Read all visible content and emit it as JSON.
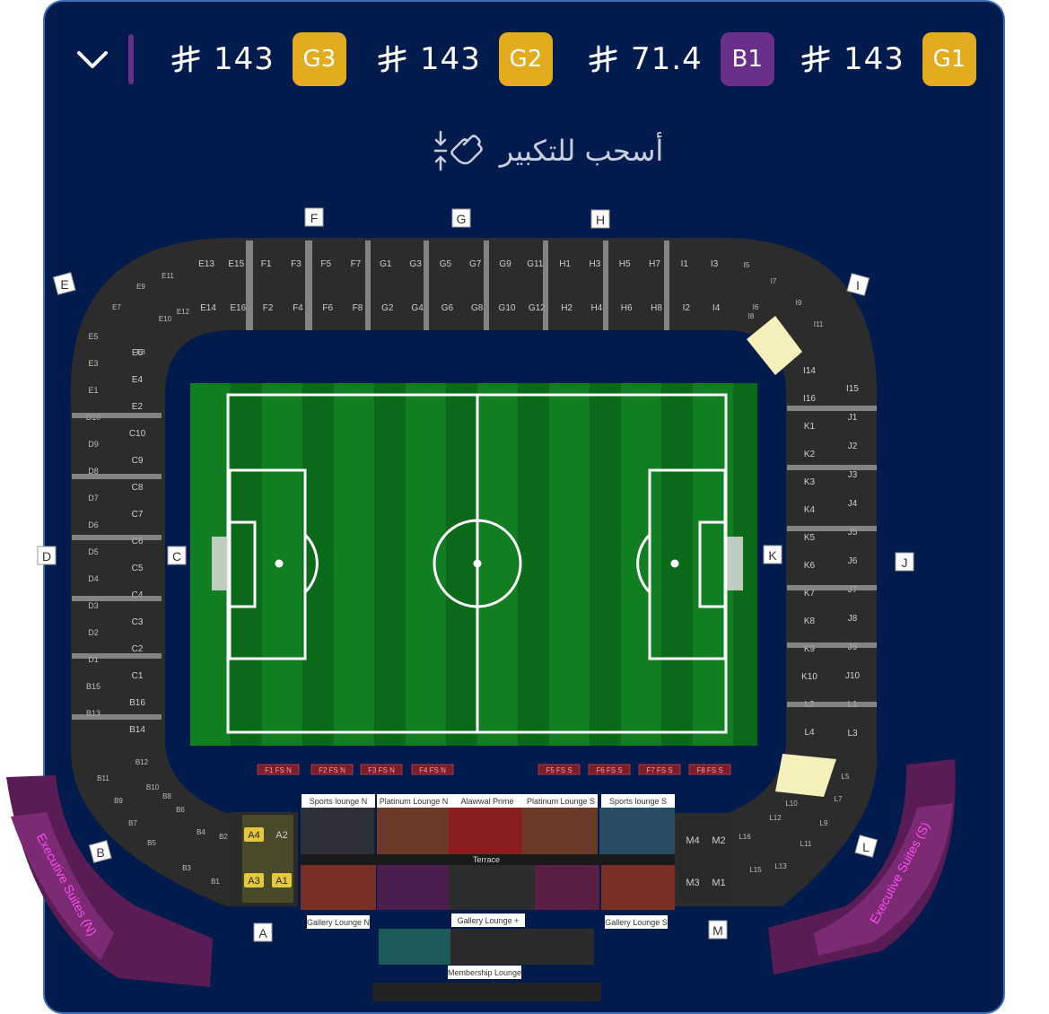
{
  "header": {
    "collapse_icon": "chevron-down-icon",
    "currency_icon": "saudi-riyal-icon",
    "prices": [
      {
        "amount": "143",
        "category": "G3",
        "color": "#e3ab1e"
      },
      {
        "amount": "143",
        "category": "G2",
        "color": "#e3ab1e"
      },
      {
        "amount": "71.4",
        "category": "B1",
        "color": "#6a2f8a"
      },
      {
        "amount": "143",
        "category": "G1",
        "color": "#e3ab1e"
      }
    ]
  },
  "hint": {
    "text": "أسحب للتكبير",
    "icon": "pinch-zoom-icon"
  },
  "colors": {
    "background": "#011b4d",
    "stand": "#2e2e2e",
    "pitch_dark": "#0d6b1c",
    "pitch_light": "#178a27",
    "selected": "#f5efbb",
    "suites": "#5a1c54"
  },
  "stand_labels": [
    "A",
    "B",
    "C",
    "D",
    "E",
    "F",
    "G",
    "H",
    "I",
    "J",
    "K",
    "L",
    "M"
  ],
  "sections": {
    "north_top": [
      "E13",
      "E15",
      "F1",
      "F3",
      "F5",
      "F7",
      "G1",
      "G3",
      "G5",
      "G7",
      "G9",
      "G11",
      "H1",
      "H3",
      "H5",
      "H7",
      "I1",
      "I3"
    ],
    "north_bottom": [
      "E14",
      "E16",
      "F2",
      "F4",
      "F6",
      "F8",
      "G2",
      "G4",
      "G6",
      "G8",
      "G10",
      "G12",
      "H2",
      "H4",
      "H6",
      "H8",
      "I2",
      "I4"
    ],
    "west_outer": [
      "E5",
      "E3",
      "E1",
      "D10",
      "D9",
      "D8",
      "D7",
      "D6",
      "D5",
      "D4",
      "D3",
      "D2",
      "D1",
      "B15",
      "B13"
    ],
    "west_inner": [
      "E6",
      "E4",
      "E2",
      "C10",
      "C9",
      "C8",
      "C7",
      "C6",
      "C5",
      "C4",
      "C3",
      "C2",
      "C1",
      "B16",
      "B14"
    ],
    "east_inner": [
      "I14",
      "I16",
      "K1",
      "K2",
      "K3",
      "K4",
      "K5",
      "K6",
      "K7",
      "K8",
      "K9",
      "K10",
      "L2",
      "L4"
    ],
    "east_outer": [
      "I15",
      "J1",
      "J2",
      "J3",
      "J4",
      "J5",
      "J6",
      "J7",
      "J8",
      "J9",
      "J10",
      "L1",
      "L3"
    ],
    "corner_nw": [
      "E9",
      "E11",
      "E7",
      "E8",
      "E10",
      "E12"
    ],
    "corner_ne": [
      "I5",
      "I7",
      "I9",
      "I11",
      "I6",
      "I8"
    ],
    "corner_sw": [
      "B11",
      "B9",
      "B7",
      "B5",
      "B3",
      "B1",
      "B12",
      "B10",
      "B8",
      "B6",
      "B4",
      "B2"
    ],
    "corner_se": [
      "L5",
      "L7",
      "L9",
      "L11",
      "L13",
      "L15",
      "L6",
      "L8",
      "L10",
      "L12",
      "L16"
    ],
    "south_a": [
      "A4",
      "A2",
      "A3",
      "A1"
    ],
    "south_m": [
      "M4",
      "M2",
      "M3",
      "M1"
    ]
  },
  "field_seats": [
    "F1 FS N",
    "F2 FS N",
    "F3 FS N",
    "F4 FS N",
    "F5 FS S",
    "F6 FS S",
    "F7 FS S",
    "F8 FS S"
  ],
  "lounges": {
    "sports_n": "Sports lounge N",
    "platinum_n": "Platinum Lounge N",
    "alawwal": "Alawwal Prime",
    "platinum_s": "Platinum Lounge S",
    "sports_s": "Sports lounge S",
    "terrace": "Terrace",
    "gallery_n": "Gallery Lounge N",
    "gallery_plus": "Gallery Lounge +",
    "gallery_s": "Gallery Lounge S",
    "membership": "Membership Lounge"
  },
  "suites": {
    "north": "Executive Suites (N)",
    "south": "Executive Suites (S)"
  }
}
